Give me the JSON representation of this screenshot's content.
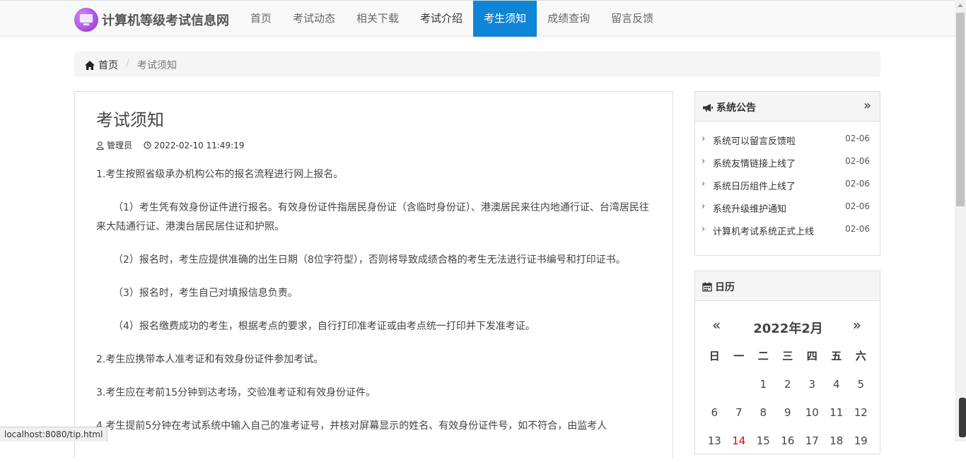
{
  "brand": {
    "name": "计算机等级考试信息网"
  },
  "nav": {
    "items": [
      {
        "label": "首页"
      },
      {
        "label": "考试动态"
      },
      {
        "label": "相关下载"
      },
      {
        "label": "考试介绍"
      },
      {
        "label": "考生须知"
      },
      {
        "label": "成绩查询"
      },
      {
        "label": "留言反馈"
      }
    ],
    "active_index": 4,
    "active_color": "#0e85d6"
  },
  "breadcrumb": {
    "home": "首页",
    "separator": "/",
    "current": "考试须知"
  },
  "article": {
    "title": "考试须知",
    "author": "管理员",
    "datetime": "2022-02-10 11:49:19",
    "paragraphs": [
      "1.考生按照省级承办机构公布的报名流程进行网上报名。",
      "（1）考生凭有效身份证件进行报名。有效身份证件指居民身份证（含临时身份证）、港澳居民来往内地通行证、台湾居民往来大陆通行证、港澳台居民居住证和护照。",
      "（2）报名时，考生应提供准确的出生日期（8位字符型），否则将导致成绩合格的考生无法进行证书编号和打印证书。",
      "（3）报名时，考生自己对填报信息负责。",
      "（4）报名缴费成功的考生，根据考点的要求，自行打印准考证或由考点统一打印并下发准考证。",
      "2.考生应携带本人准考证和有效身份证件参加考试。",
      "3.考生应在考前15分钟到达考场，交验准考证和有效身份证件。",
      "4.考生提前5分钟在考试系统中输入自己的准考证号，并核对屏幕显示的姓名、有效身份证件号，如不符合，由监考人"
    ]
  },
  "announcements": {
    "title": "系统公告",
    "more": "»",
    "items": [
      {
        "text": "系统可以留言反馈啦",
        "date": "02-06"
      },
      {
        "text": "系统友情链接上线了",
        "date": "02-06"
      },
      {
        "text": "系统日历组件上线了",
        "date": "02-06"
      },
      {
        "text": "系统升级维护通知",
        "date": "02-06"
      },
      {
        "text": "计算机考试系统正式上线",
        "date": "02-06"
      }
    ]
  },
  "calendar": {
    "title": "日历",
    "prev": "«",
    "next": "»",
    "month_label": "2022年2月",
    "weekdays": [
      "日",
      "一",
      "二",
      "三",
      "四",
      "五",
      "六"
    ],
    "weeks": [
      [
        "",
        "",
        "1",
        "2",
        "3",
        "4",
        "5"
      ],
      [
        "6",
        "7",
        "8",
        "9",
        "10",
        "11",
        "12"
      ],
      [
        "13",
        "14",
        "15",
        "16",
        "17",
        "18",
        "19"
      ]
    ],
    "today": "14",
    "today_color": "#e00000"
  },
  "status_bar": {
    "url": "localhost:8080/tip.html"
  }
}
